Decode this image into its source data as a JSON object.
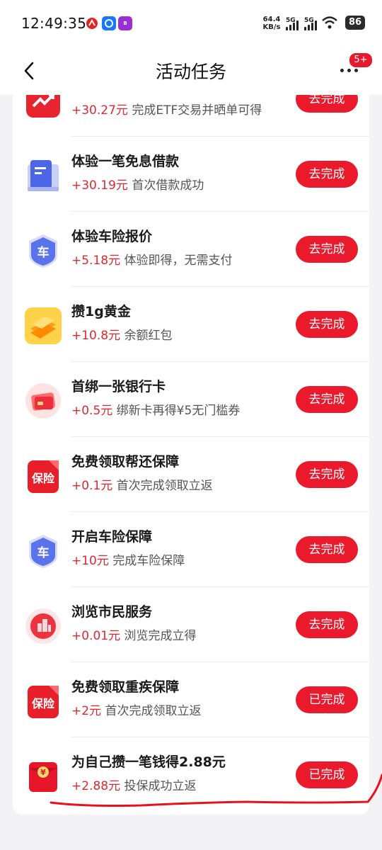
{
  "status_bar": {
    "time": "12:49:35",
    "net_speed_value": "64.4",
    "net_speed_unit": "KB/s",
    "sim1": "5G",
    "sim2": "5G",
    "battery": "86"
  },
  "nav": {
    "title": "活动任务",
    "badge": "5+"
  },
  "tasks": [
    {
      "title": "",
      "amount": "+30.27元",
      "desc": " 完成ETF交易并晒单可得",
      "button": "去完成",
      "icon": "trend-chart-icon"
    },
    {
      "title": "体验一笔免息借款",
      "amount": "+30.19元",
      "desc": " 首次借款成功",
      "button": "去完成",
      "icon": "document-icon"
    },
    {
      "title": "体验车险报价",
      "amount": "+5.18元",
      "desc": " 体验即得，无需支付",
      "button": "去完成",
      "icon": "car-shield-icon",
      "icon_text": "车"
    },
    {
      "title": "攒1g黄金",
      "amount": "+10.8元",
      "desc": " 余额红包",
      "button": "去完成",
      "icon": "gold-bars-icon"
    },
    {
      "title": "首绑一张银行卡",
      "amount": "+0.5元",
      "desc": " 绑新卡再得¥5无门槛券",
      "button": "去完成",
      "icon": "bank-card-icon"
    },
    {
      "title": "免费领取帮还保障",
      "amount": "+0.1元",
      "desc": " 首次完成领取立返",
      "button": "去完成",
      "icon": "insurance-icon",
      "icon_text": "保险"
    },
    {
      "title": "开启车险保障",
      "amount": "+10元",
      "desc": " 完成车险保障",
      "button": "去完成",
      "icon": "car-shield-icon",
      "icon_text": "车"
    },
    {
      "title": "浏览市民服务",
      "amount": "+0.01元",
      "desc": " 浏览完成立得",
      "button": "去完成",
      "icon": "city-service-icon"
    },
    {
      "title": "免费领取重疾保障",
      "amount": "+2元",
      "desc": " 首次完成领取立返",
      "button": "已完成",
      "icon": "insurance-icon",
      "icon_text": "保险"
    },
    {
      "title": "为自己攒一笔钱得2.88元",
      "amount": "+2.88元",
      "desc": " 投保成功立返",
      "button": "已完成",
      "icon": "red-envelope-icon",
      "icon_text": "¥"
    }
  ],
  "colors": {
    "accent": "#ea1a2c",
    "amount": "#e5262f",
    "background": "#f3f3f5",
    "annotation": "#e8101c"
  }
}
